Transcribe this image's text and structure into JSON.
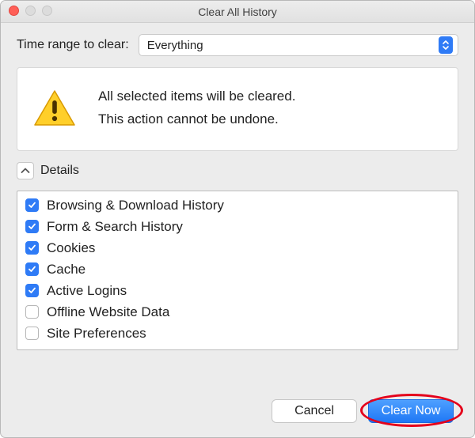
{
  "window": {
    "title": "Clear All History"
  },
  "range": {
    "label": "Time range to clear:",
    "value": "Everything"
  },
  "warning": {
    "line1": "All selected items will be cleared.",
    "line2": "This action cannot be undone."
  },
  "details": {
    "label": "Details"
  },
  "items": [
    {
      "label": "Browsing & Download History",
      "checked": true
    },
    {
      "label": "Form & Search History",
      "checked": true
    },
    {
      "label": "Cookies",
      "checked": true
    },
    {
      "label": "Cache",
      "checked": true
    },
    {
      "label": "Active Logins",
      "checked": true
    },
    {
      "label": "Offline Website Data",
      "checked": false
    },
    {
      "label": "Site Preferences",
      "checked": false
    }
  ],
  "buttons": {
    "cancel": "Cancel",
    "clear": "Clear Now"
  },
  "colors": {
    "accent": "#2f7bf6",
    "highlight": "#e4001b"
  }
}
